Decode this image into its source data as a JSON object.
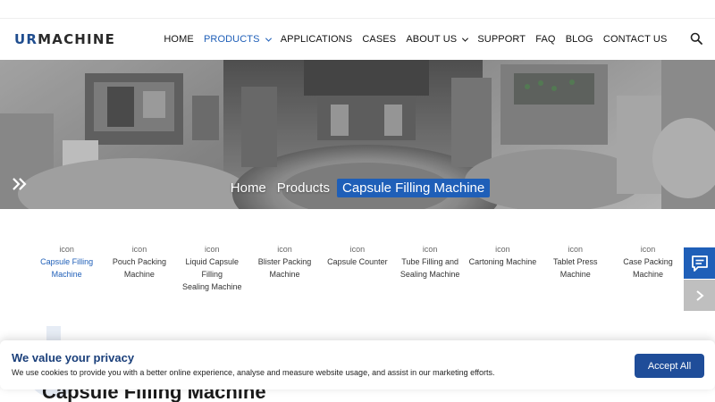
{
  "logo": {
    "prefix": "UR",
    "suffix": "MACHINE"
  },
  "nav": {
    "items": [
      {
        "label": "HOME",
        "active": false,
        "has_dropdown": false
      },
      {
        "label": "PRODUCTS",
        "active": true,
        "has_dropdown": true
      },
      {
        "label": "APPLICATIONS",
        "active": false,
        "has_dropdown": false
      },
      {
        "label": "CASES",
        "active": false,
        "has_dropdown": false
      },
      {
        "label": "ABOUT US",
        "active": false,
        "has_dropdown": true
      },
      {
        "label": "SUPPORT",
        "active": false,
        "has_dropdown": false
      },
      {
        "label": "FAQ",
        "active": false,
        "has_dropdown": false
      },
      {
        "label": "BLOG",
        "active": false,
        "has_dropdown": false
      },
      {
        "label": "CONTACT US",
        "active": false,
        "has_dropdown": false
      }
    ],
    "search_icon": "search-icon"
  },
  "breadcrumb": {
    "home": "Home",
    "products": "Products",
    "current": "Capsule Filling Machine",
    "separator_icon": "double-chevron-right-icon"
  },
  "categories": [
    {
      "icon": "icon",
      "label_line1": "Capsule Filling",
      "label_line2": "Machine",
      "active": true
    },
    {
      "icon": "icon",
      "label_line1": "Pouch Packing",
      "label_line2": "Machine",
      "active": false
    },
    {
      "icon": "icon",
      "label_line1": "Liquid Capsule Filling",
      "label_line2": "Sealing Machine",
      "active": false
    },
    {
      "icon": "icon",
      "label_line1": "Blister Packing",
      "label_line2": "Machine",
      "active": false
    },
    {
      "icon": "icon",
      "label_line1": "Capsule Counter",
      "label_line2": "",
      "active": false
    },
    {
      "icon": "icon",
      "label_line1": "Tube Filling and",
      "label_line2": "Sealing Machine",
      "active": false
    },
    {
      "icon": "icon",
      "label_line1": "Cartoning Machine",
      "label_line2": "",
      "active": false
    },
    {
      "icon": "icon",
      "label_line1": "Tablet Press",
      "label_line2": "Machine",
      "active": false
    },
    {
      "icon": "icon",
      "label_line1": "Case Packing",
      "label_line2": "Machine",
      "active": false
    }
  ],
  "side": {
    "chat_icon": "chat-icon",
    "next_icon": "chevron-right-icon"
  },
  "section": {
    "title": "Capsule Filling Machine"
  },
  "cookie": {
    "title": "We value your privacy",
    "text": "We use cookies to provide you with a better online experience, analyse and measure website usage, and assist in our marketing efforts.",
    "accept_label": "Accept All"
  },
  "colors": {
    "accent": "#1f5fb8",
    "button": "#1f4d99",
    "title": "#1a3f7a"
  }
}
